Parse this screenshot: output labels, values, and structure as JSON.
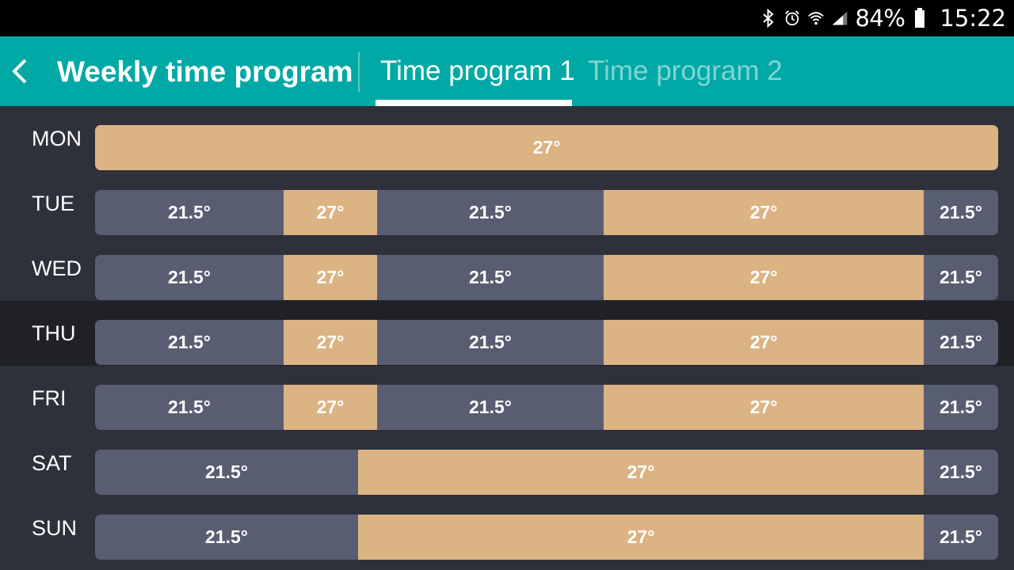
{
  "status_bar": {
    "icons": [
      "bluetooth-icon",
      "alarm-icon",
      "wifi-icon",
      "signal-icon"
    ],
    "battery_percent": "84%",
    "time": "15:22"
  },
  "app_bar": {
    "back_icon": "chevron-left-icon",
    "title": "Weekly time program",
    "tabs": [
      {
        "label": "Time program 1",
        "active": true
      },
      {
        "label": "Time program 2",
        "active": false
      }
    ]
  },
  "colors": {
    "appbar": "#00a9a5",
    "low_temp": "#595d72",
    "high_temp": "#dcb383",
    "background": "#2e313a"
  },
  "schedule": [
    {
      "day": "MON",
      "segments": [
        {
          "label": "27°",
          "kind": "high",
          "fraction": 1.0
        }
      ]
    },
    {
      "day": "TUE",
      "segments": [
        {
          "label": "21.5°",
          "kind": "low",
          "fraction": 0.209
        },
        {
          "label": "27°",
          "kind": "high",
          "fraction": 0.1035
        },
        {
          "label": "21.5°",
          "kind": "low",
          "fraction": 0.251
        },
        {
          "label": "27°",
          "kind": "high",
          "fraction": 0.354
        },
        {
          "label": "21.5°",
          "kind": "low",
          "fraction": 0.0825
        }
      ]
    },
    {
      "day": "WED",
      "segments": [
        {
          "label": "21.5°",
          "kind": "low",
          "fraction": 0.209
        },
        {
          "label": "27°",
          "kind": "high",
          "fraction": 0.1035
        },
        {
          "label": "21.5°",
          "kind": "low",
          "fraction": 0.251
        },
        {
          "label": "27°",
          "kind": "high",
          "fraction": 0.354
        },
        {
          "label": "21.5°",
          "kind": "low",
          "fraction": 0.0825
        }
      ]
    },
    {
      "day": "THU",
      "highlighted": true,
      "segments": [
        {
          "label": "21.5°",
          "kind": "low",
          "fraction": 0.209
        },
        {
          "label": "27°",
          "kind": "high",
          "fraction": 0.1035
        },
        {
          "label": "21.5°",
          "kind": "low",
          "fraction": 0.251
        },
        {
          "label": "27°",
          "kind": "high",
          "fraction": 0.354
        },
        {
          "label": "21.5°",
          "kind": "low",
          "fraction": 0.0825
        }
      ]
    },
    {
      "day": "FRI",
      "segments": [
        {
          "label": "21.5°",
          "kind": "low",
          "fraction": 0.209
        },
        {
          "label": "27°",
          "kind": "high",
          "fraction": 0.1035
        },
        {
          "label": "21.5°",
          "kind": "low",
          "fraction": 0.251
        },
        {
          "label": "27°",
          "kind": "high",
          "fraction": 0.354
        },
        {
          "label": "21.5°",
          "kind": "low",
          "fraction": 0.0825
        }
      ]
    },
    {
      "day": "SAT",
      "segments": [
        {
          "label": "21.5°",
          "kind": "low",
          "fraction": 0.291
        },
        {
          "label": "27°",
          "kind": "high",
          "fraction": 0.6265
        },
        {
          "label": "21.5°",
          "kind": "low",
          "fraction": 0.0825
        }
      ]
    },
    {
      "day": "SUN",
      "segments": [
        {
          "label": "21.5°",
          "kind": "low",
          "fraction": 0.291
        },
        {
          "label": "27°",
          "kind": "high",
          "fraction": 0.6265
        },
        {
          "label": "21.5°",
          "kind": "low",
          "fraction": 0.0825
        }
      ]
    }
  ]
}
